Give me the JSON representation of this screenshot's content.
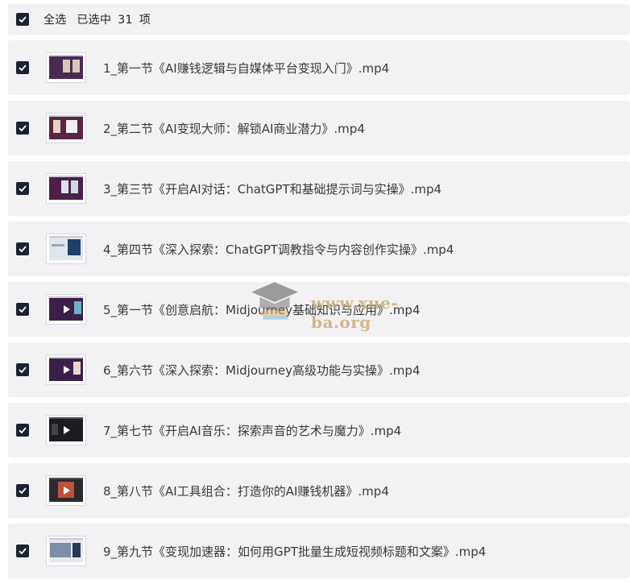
{
  "header": {
    "select_all": "全选",
    "selected_prefix": "已选中",
    "selected_count": "31",
    "selected_suffix": "项"
  },
  "files": [
    {
      "name": "1_第一节《AI赚钱逻辑与自媒体平台变现入门》.mp4",
      "thumb": "slide-with-faces"
    },
    {
      "name": "2_第二节《AI变现大师：解锁AI商业潜力》.mp4",
      "thumb": "slide-with-faces"
    },
    {
      "name": "3_第三节《开启AI对话：ChatGPT和基础提示词与实操》.mp4",
      "thumb": "slide-with-faces"
    },
    {
      "name": "4_第四节《深入探索：ChatGPT调教指令与内容创作实操》.mp4",
      "thumb": "screen-recording"
    },
    {
      "name": "5_第一节《创意启航：Midjourney基础知识与应用》.mp4",
      "thumb": "slide-play"
    },
    {
      "name": "6_第六节《深入探索：Midjourney高级功能与实操》.mp4",
      "thumb": "slide-play"
    },
    {
      "name": "7_第七节《开启AI音乐：探索声音的艺术与魔力》.mp4",
      "thumb": "dark-play"
    },
    {
      "name": "8_第八节《AI工具组合：打造你的AI赚钱机器》.mp4",
      "thumb": "dark-play"
    },
    {
      "name": "9_第九节《变现加速器：如何用GPT批量生成短视频标题和文案》.mp4",
      "thumb": "screen-recording"
    }
  ],
  "watermark": {
    "text": "www.xue-ba.org",
    "icon": "graduation-cap-icon"
  },
  "colors": {
    "row_bg": "#f2f2f4",
    "checkbox": "#1a2233",
    "watermark": "#c8a46a"
  }
}
